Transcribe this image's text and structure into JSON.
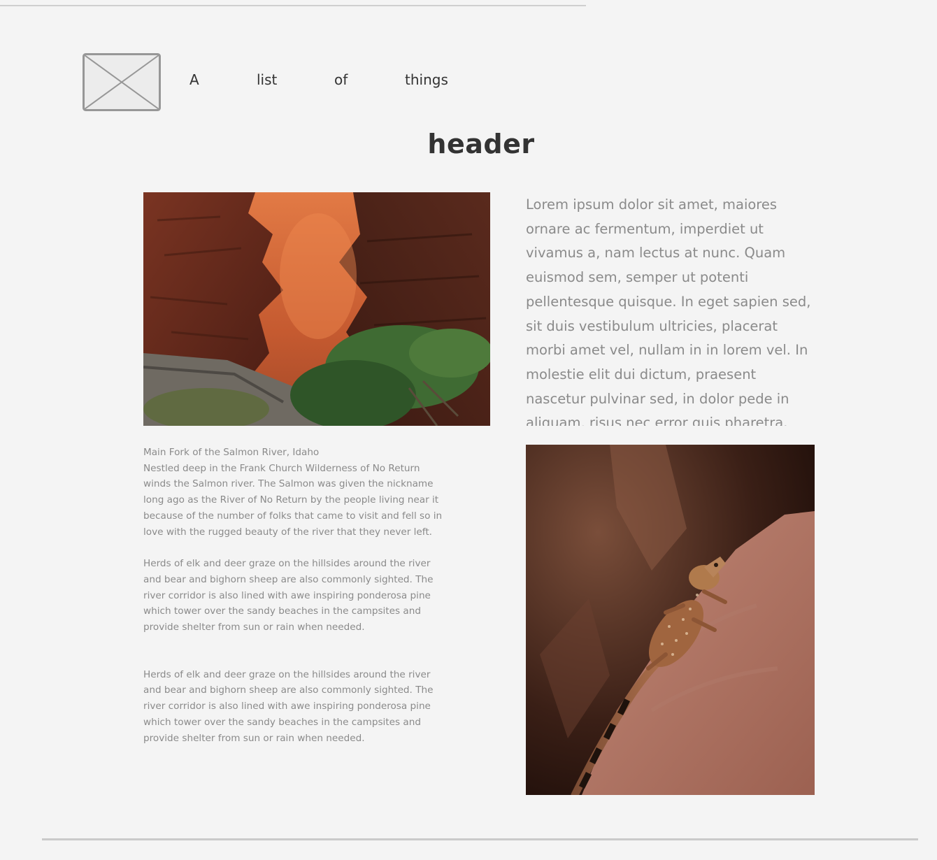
{
  "nav": {
    "items": [
      "A",
      "list",
      "of",
      "things"
    ]
  },
  "header": {
    "title": "header"
  },
  "icons": {
    "logo": "image-placeholder-icon"
  },
  "lede": {
    "text": "Lorem ipsum dolor sit amet, maiores ornare ac fermentum, imperdiet ut vivamus a, nam lectus at nunc. Quam euismod sem, semper ut potenti pellentesque quisque. In eget sapien sed, sit duis vestibulum ultricies, placerat morbi amet vel, nullam in in lorem vel. In molestie elit dui dictum, praesent nascetur pulvinar sed, in dolor pede in aliquam, risus nec error quis pharetra. Eros metus"
  },
  "article": {
    "caption_title": "Main Fork of the Salmon River, Idaho",
    "paragraph_1": "Nestled deep in the Frank Church Wilderness of No Return winds the Salmon river. The Salmon was given the nickname long ago as the River of No Return by the people living near it because of the number of folks that came to visit and fell so in love with the rugged beauty of the river that they never left.",
    "paragraph_2": "Herds of elk and deer graze on the hillsides around the river and bear and bighorn sheep are also commonly sighted. The river corridor is also lined with awe inspiring ponderosa pine which tower over the sandy beaches in the campsites and provide shelter from sun or rain when needed.",
    "paragraph_3": "Herds of elk and deer graze on the hillsides around the river and bear and bighorn sheep are also commonly sighted. The river corridor is also lined with awe inspiring ponderosa pine which tower over the sandy beaches in the campsites and provide shelter from sun or rain when needed."
  },
  "colors": {
    "background": "#f4f4f4",
    "heading": "#333333",
    "body_text": "#8a8a8a",
    "rule": "#cacaca"
  }
}
